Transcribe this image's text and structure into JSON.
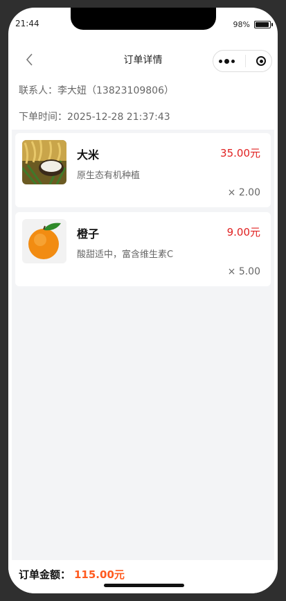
{
  "status": {
    "time": "21:44",
    "battery": "98%"
  },
  "navbar": {
    "title": "订单详情"
  },
  "order": {
    "contact_label": "联系人：",
    "contact_value": "李大妞（13823109806）",
    "time_label": "下单时间：",
    "time_value": "2025-12-28 21:37:43"
  },
  "items": [
    {
      "name": "大米",
      "price": "35.00元",
      "desc": "原生态有机种植",
      "qty": "× 2.00"
    },
    {
      "name": "橙子",
      "price": "9.00元",
      "desc": "酸甜适中，富含维生素C",
      "qty": "× 5.00"
    }
  ],
  "footer": {
    "total_label": "订单金额：",
    "total_value": "115.00元"
  },
  "colors": {
    "price": "#e02020",
    "total": "#ff5a1f",
    "background": "#f3f4f6"
  },
  "icons": [
    "back-icon",
    "more-icon",
    "close-target-icon",
    "battery-icon"
  ]
}
